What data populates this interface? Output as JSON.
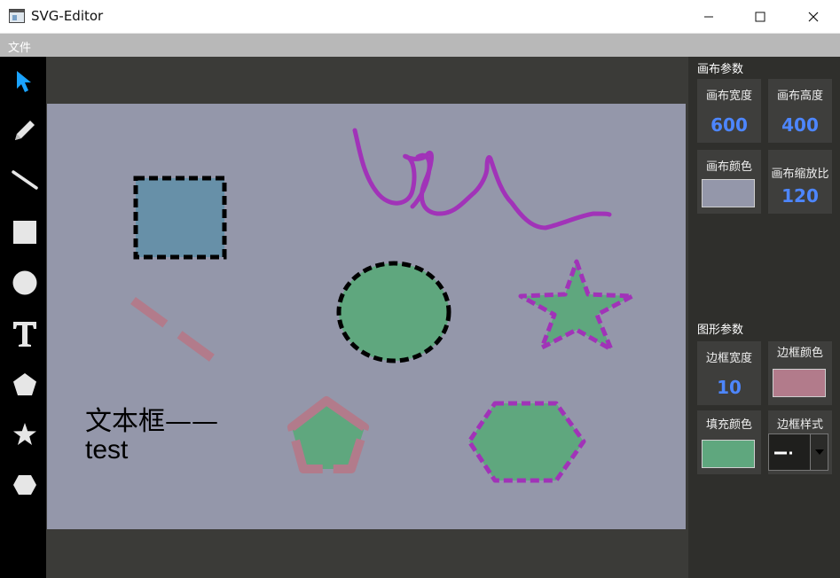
{
  "window": {
    "title": "SVG-Editor"
  },
  "menu": {
    "file": "文件"
  },
  "tools": [
    "select-icon",
    "pencil-icon",
    "line-icon",
    "rectangle-icon",
    "circle-icon",
    "text-icon",
    "pentagon-icon",
    "star-icon",
    "hexagon-icon"
  ],
  "canvas_text": {
    "line1": "文本框——",
    "line2": "test"
  },
  "canvas_params": {
    "title": "画布参数",
    "width_label": "画布宽度",
    "width_value": "600",
    "height_label": "画布高度",
    "height_value": "400",
    "color_label": "画布颜色",
    "color_value": "#9497aa",
    "zoom_label": "画布缩放比",
    "zoom_value": "120"
  },
  "shape_params": {
    "title": "图形参数",
    "border_width_label": "边框宽度",
    "border_width_value": "10",
    "border_color_label": "边框颜色",
    "border_color_value": "#b27b8b",
    "fill_color_label": "填充颜色",
    "fill_color_value": "#5fa77e",
    "border_style_label": "边框样式"
  },
  "colors": {
    "accent": "#4d86ff",
    "select_tool": "#1aa3ff",
    "menu_bar": "#b8b8b8"
  }
}
